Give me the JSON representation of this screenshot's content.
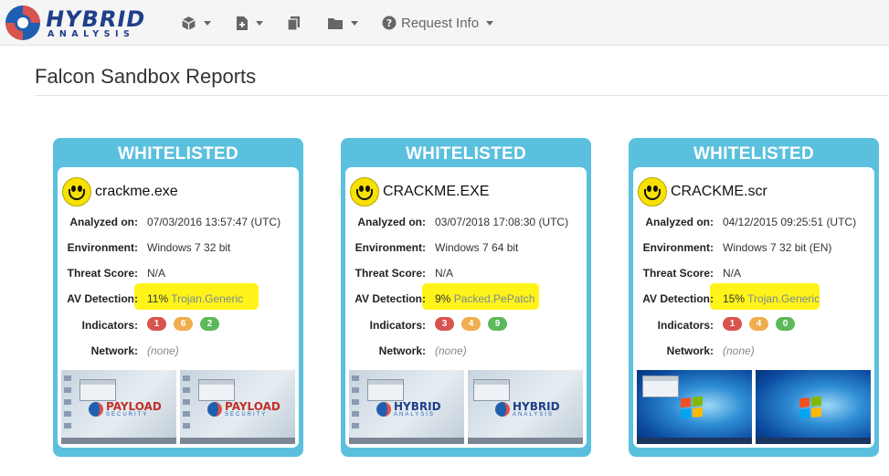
{
  "header": {
    "logo_text": "HYBRID",
    "logo_sub": "ANALYSIS",
    "nav": [
      {
        "icon": "cube-icon"
      },
      {
        "icon": "file-plus-icon"
      },
      {
        "icon": "copy-icon"
      },
      {
        "icon": "folder-icon"
      },
      {
        "icon": "question-circle-icon",
        "label": "Request Info"
      }
    ]
  },
  "page": {
    "title": "Falcon Sandbox Reports"
  },
  "labels": {
    "analyzed_on": "Analyzed on:",
    "environment": "Environment:",
    "threat_score": "Threat Score:",
    "av_detection": "AV Detection:",
    "indicators": "Indicators:",
    "network": "Network:"
  },
  "cards": [
    {
      "verdict": "WHITELISTED",
      "filename": "crackme.exe",
      "analyzed_on": "07/03/2016 13:57:47 (UTC)",
      "environment": "Windows 7 32 bit",
      "threat_score": "N/A",
      "av_percent": "11%",
      "av_name": "Trojan.Generic",
      "indicators": [
        "1",
        "6",
        "2"
      ],
      "network": "(none)",
      "screenshots": [
        "payload-security",
        "payload-security"
      ]
    },
    {
      "verdict": "WHITELISTED",
      "filename": "CRACKME.EXE",
      "analyzed_on": "03/07/2018 17:08:30 (UTC)",
      "environment": "Windows 7 64 bit",
      "threat_score": "N/A",
      "av_percent": "9%",
      "av_name": "Packed.PePatch",
      "indicators": [
        "3",
        "4",
        "9"
      ],
      "network": "(none)",
      "screenshots": [
        "hybrid-desktop",
        "hybrid-desktop"
      ]
    },
    {
      "verdict": "WHITELISTED",
      "filename": "CRACKME.scr",
      "analyzed_on": "04/12/2015 09:25:51 (UTC)",
      "environment": "Windows 7 32 bit (EN)",
      "threat_score": "N/A",
      "av_percent": "15%",
      "av_name": "Trojan.Generic",
      "indicators": [
        "1",
        "4",
        "0"
      ],
      "network": "(none)",
      "screenshots": [
        "windows7-desktop",
        "windows7-desktop"
      ]
    }
  ],
  "colors": {
    "card_accent": "#5bc0de",
    "highlight": "#fff200",
    "indicator_malicious": "#d9534f",
    "indicator_suspicious": "#f0ad4e",
    "indicator_informative": "#5cb85c"
  }
}
